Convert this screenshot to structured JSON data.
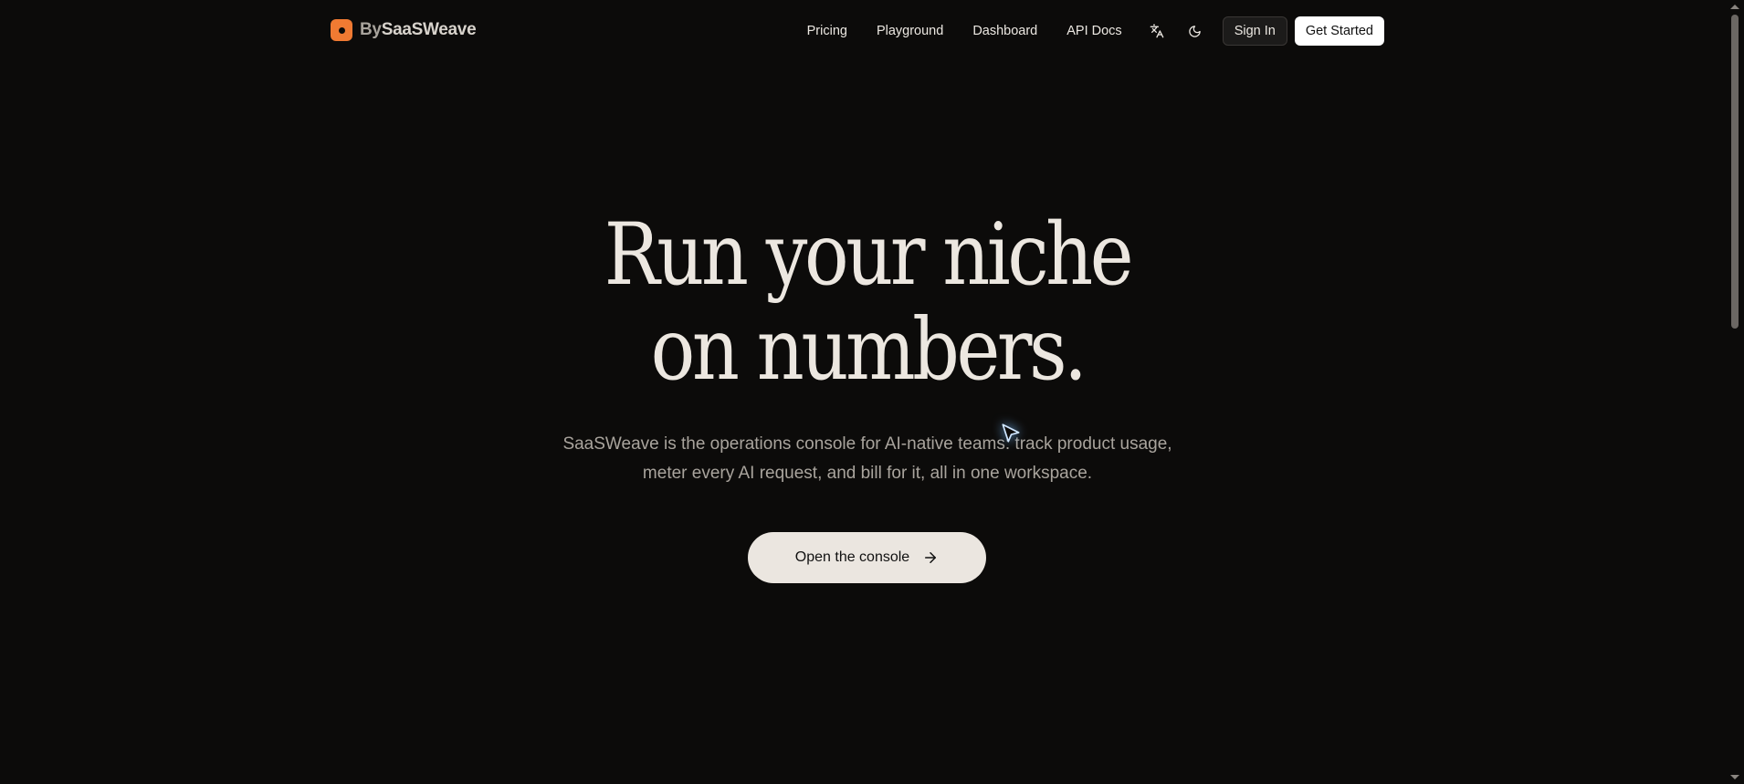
{
  "header": {
    "brand": {
      "prefix": "By",
      "name": "SaaSWeave",
      "logo_icon": "orange-rounded-square-logo-icon",
      "logo_color": "#f07a32"
    },
    "nav": [
      {
        "label": "Pricing"
      },
      {
        "label": "Playground"
      },
      {
        "label": "Dashboard"
      },
      {
        "label": "API Docs"
      }
    ],
    "language_icon": "translate-icon",
    "theme_icon": "moon-icon",
    "sign_in_label": "Sign In",
    "get_started_label": "Get Started"
  },
  "hero": {
    "headline_line1": "Run your niche",
    "headline_line2": "on numbers.",
    "subtitle": "SaaSWeave is the operations console for AI-native teams: track product usage, meter every AI request, and bill for it, all in one workspace.",
    "cta_label": "Open the console",
    "cta_icon": "arrow-right-icon"
  },
  "colors": {
    "background": "#0c0b0a",
    "accent": "#f07a32",
    "headline": "#ece7e0",
    "subtitle": "#a9a49d",
    "cta_background": "#ebe6e0"
  }
}
